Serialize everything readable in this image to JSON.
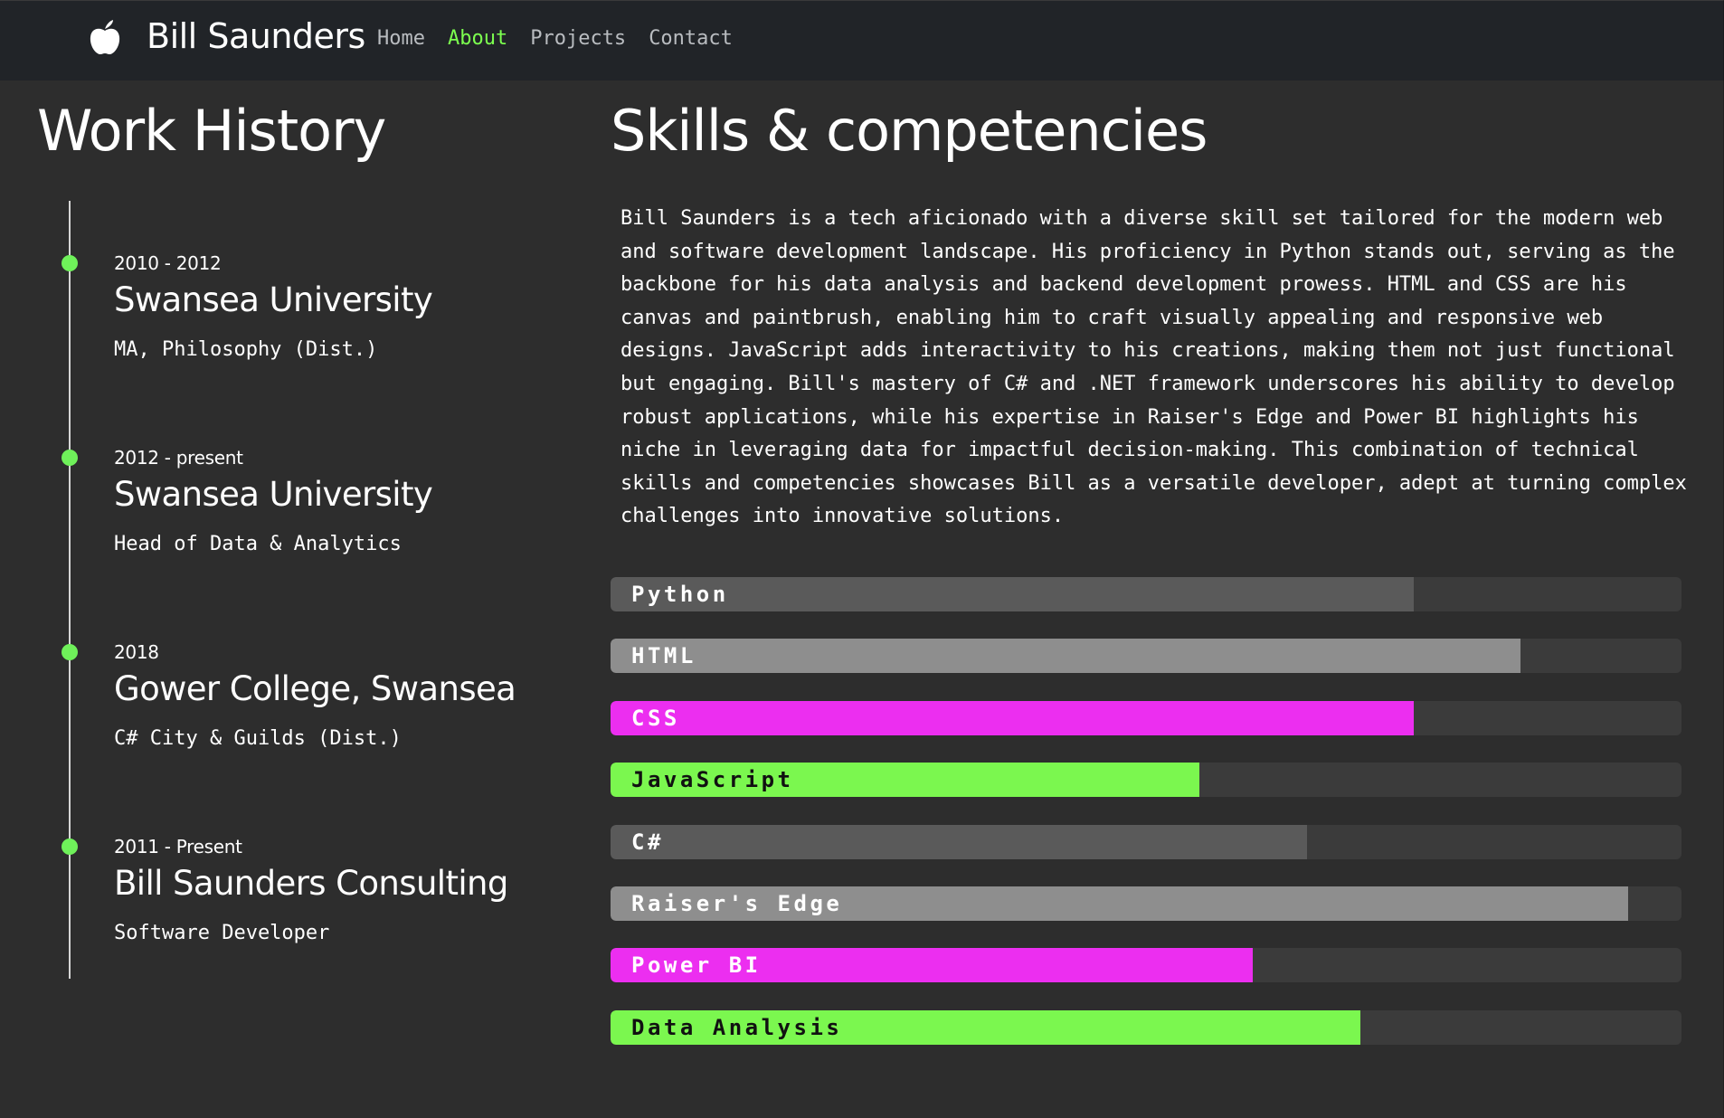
{
  "brand": {
    "name": "Bill Saunders",
    "icon": "apple-icon"
  },
  "nav": {
    "active": "About",
    "active_color": "#7cff4f",
    "links": [
      "Home",
      "About",
      "Projects",
      "Contact"
    ]
  },
  "work_history": {
    "title": "Work History",
    "items": [
      {
        "date": "2010 - 2012",
        "org": "Swansea University",
        "role": "MA, Philosophy (Dist.)"
      },
      {
        "date": "2012 - present",
        "org": "Swansea University",
        "role": "Head of Data & Analytics"
      },
      {
        "date": "2018",
        "org": "Gower College, Swansea",
        "role": "C# City & Guilds (Dist.)"
      },
      {
        "date": "2011 - Present",
        "org": "Bill Saunders Consulting",
        "role": "Software Developer"
      }
    ]
  },
  "skills": {
    "title": "Skills & competencies",
    "description": "Bill Saunders is a tech aficionado with a diverse skill set tailored for the modern web and software development landscape. His proficiency in Python stands out, serving as the backbone for his data analysis and backend development prowess. HTML and CSS are his canvas and paintbrush, enabling him to craft visually appealing and responsive web designs. JavaScript adds interactivity to his creations, making them not just functional but engaging. Bill's mastery of C# and .NET framework underscores his ability to develop robust applications, while his expertise in Raiser's Edge and Power BI highlights his niche in leveraging data for impactful decision-making. This combination of technical skills and competencies showcases Bill as a versatile developer, adept at turning complex challenges into innovative solutions.",
    "bars": [
      {
        "label": "Python",
        "level": 0.75,
        "fill_color": "#5a5a5a",
        "text_color": "#ffffff"
      },
      {
        "label": "HTML",
        "level": 0.85,
        "fill_color": "#8e8e8e",
        "text_color": "#ffffff"
      },
      {
        "label": "CSS",
        "level": 0.75,
        "fill_color": "#ec2ef0",
        "text_color": "#ffffff"
      },
      {
        "label": "JavaScript",
        "level": 0.55,
        "fill_color": "#7bf74f",
        "text_color": "#111111"
      },
      {
        "label": "C#",
        "level": 0.65,
        "fill_color": "#5a5a5a",
        "text_color": "#ffffff"
      },
      {
        "label": "Raiser's Edge",
        "level": 0.95,
        "fill_color": "#8e8e8e",
        "text_color": "#ffffff"
      },
      {
        "label": "Power BI",
        "level": 0.6,
        "fill_color": "#ec2ef0",
        "text_color": "#ffffff"
      },
      {
        "label": "Data Analysis",
        "level": 0.7,
        "fill_color": "#7bf74f",
        "text_color": "#111111"
      }
    ]
  }
}
